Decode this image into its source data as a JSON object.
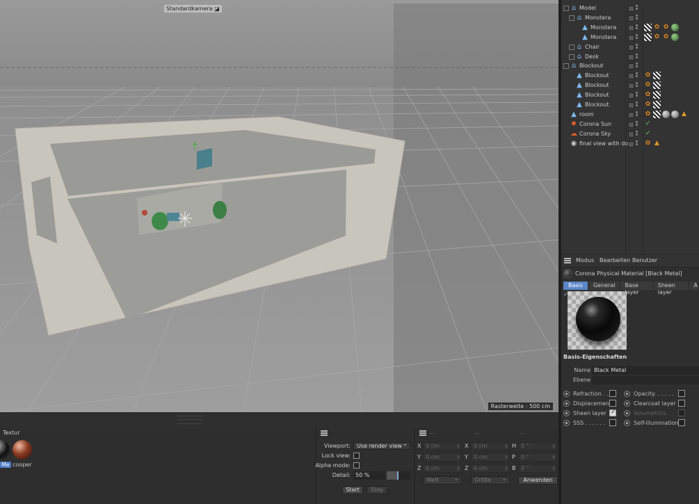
{
  "viewport": {
    "camera_label": "Standardkamera",
    "raster_label": "Rasterweite : 500 cm"
  },
  "objects": [
    {
      "name": "Model",
      "depth": 0,
      "expander": true,
      "icon": "null-object-icon",
      "tags": []
    },
    {
      "name": "Monstera",
      "depth": 1,
      "expander": true,
      "icon": "null-object-icon",
      "tags": []
    },
    {
      "name": "Monstera",
      "depth": 2,
      "expander": false,
      "icon": "mesh-object-icon",
      "tags": [
        "checker",
        "orange",
        "orange",
        "sphere"
      ]
    },
    {
      "name": "Monstera",
      "depth": 2,
      "expander": false,
      "icon": "mesh-object-icon",
      "tags": [
        "checker",
        "orange",
        "orange",
        "sphere"
      ]
    },
    {
      "name": "Chair",
      "depth": 1,
      "expander": true,
      "icon": "null-object-icon",
      "tags": []
    },
    {
      "name": "Desk",
      "depth": 1,
      "expander": true,
      "icon": "null-object-icon",
      "tags": []
    },
    {
      "name": "Blockout",
      "depth": 0,
      "expander": true,
      "icon": "null-object-icon",
      "tags": []
    },
    {
      "name": "Blockout",
      "depth": 1,
      "expander": false,
      "icon": "mesh-object-icon",
      "tags": [
        "orange",
        "checker"
      ]
    },
    {
      "name": "Blockout",
      "depth": 1,
      "expander": false,
      "icon": "mesh-object-icon",
      "tags": [
        "orange",
        "checker"
      ]
    },
    {
      "name": "Blockout",
      "depth": 1,
      "expander": false,
      "icon": "mesh-object-icon",
      "tags": [
        "orange",
        "checker"
      ]
    },
    {
      "name": "Blockout",
      "depth": 1,
      "expander": false,
      "icon": "mesh-object-icon",
      "tags": [
        "orange",
        "checker"
      ]
    },
    {
      "name": "room",
      "depth": 0,
      "expander": false,
      "icon": "mesh-object-icon",
      "tags": [
        "orange",
        "checker",
        "gsphere",
        "gsphere",
        "tri"
      ]
    },
    {
      "name": "Corona Sun",
      "depth": 0,
      "expander": false,
      "icon": "sun-icon",
      "tags": [
        "check"
      ]
    },
    {
      "name": "Corona Sky",
      "depth": 0,
      "expander": false,
      "icon": "sky-icon",
      "tags": [
        "check"
      ]
    },
    {
      "name": "final view with dof",
      "depth": 0,
      "expander": false,
      "icon": "camera-icon",
      "tags": [
        "orange",
        "tri"
      ]
    }
  ],
  "attributes": {
    "menu": [
      "Modus",
      "Bearbeiten",
      "Benutzer"
    ],
    "material_title": "Corona Physical Material [Black Metal]",
    "tabs": [
      "Basis",
      "General",
      "Base layer",
      "Sheen layer",
      "Adv"
    ],
    "active_tab": "Basis",
    "section_title": "Basis-Eigenschaften",
    "name_label": "Name",
    "name_value": "Black Metal",
    "layer_label": "Ebene",
    "layer_value": "",
    "options_left": [
      {
        "label": "Refraction . .",
        "checked": false
      },
      {
        "label": "Displacement",
        "checked": false
      },
      {
        "label": "Sheen layer",
        "checked": true
      },
      {
        "label": "SSS . . . . . .",
        "checked": false
      }
    ],
    "options_right": [
      {
        "label": "Opacity. . . . . .",
        "checked": false,
        "dim": false
      },
      {
        "label": "Clearcoat layer",
        "checked": false,
        "dim": false
      },
      {
        "label": "Volumetrics . .",
        "checked": false,
        "dim": true
      },
      {
        "label": "Self-illumination",
        "checked": false,
        "dim": false
      }
    ]
  },
  "material_panel": {
    "label": "Textur",
    "materials": [
      {
        "name": "Me",
        "color": "#2a2a2a"
      },
      {
        "name": "cooper",
        "color": "#8a3a22"
      }
    ]
  },
  "viewport_panel": {
    "viewport_label": "Viewport:",
    "viewport_value": "Use render view",
    "lock_label": "Lock view:",
    "alpha_label": "Alpha mode:",
    "detail_label": "Detail:",
    "detail_value": "50 %",
    "detail_fraction": 0.5,
    "start_label": "Start",
    "stop_label": "Stop"
  },
  "coord_panel": {
    "headers": [
      "---",
      "---",
      "---"
    ],
    "rows": [
      {
        "a1": "X",
        "v1": "0 cm",
        "a2": "X",
        "v2": "0 cm",
        "a3": "H",
        "v3": "0 °"
      },
      {
        "a1": "Y",
        "v1": "0 cm",
        "a2": "Y",
        "v2": "0 cm",
        "a3": "P",
        "v3": "0 °"
      },
      {
        "a1": "Z",
        "v1": "0 cm",
        "a2": "Z",
        "v2": "0 cm",
        "a3": "B",
        "v3": "0 °"
      }
    ],
    "world_label": "Welt",
    "size_label": "Größe",
    "apply_label": "Anwenden"
  },
  "colors": {
    "accent": "#5a86c8",
    "viewport_bg": "#8c8c8c",
    "panel_bg": "#2e2e2e"
  }
}
